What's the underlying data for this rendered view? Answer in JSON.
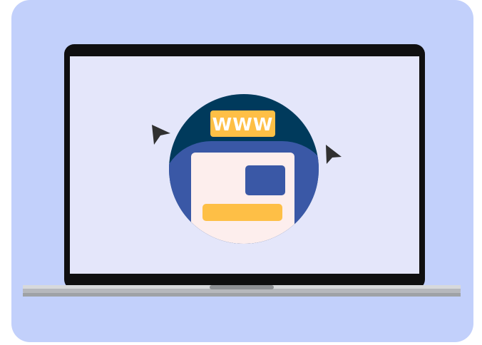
{
  "illustration": {
    "badge_text": "WWW",
    "colors": {
      "background": "#c2d0fb",
      "bezel": "#0f0f10",
      "screen": "#e4e6fa",
      "base_top": "#d7d9dc",
      "base_bottom": "#9fa2a6",
      "circle_dark": "#003a5c",
      "circle_blue": "#3a58a6",
      "page": "#fdeeed",
      "badge": "#febf46",
      "badge_text": "#ffffff",
      "image_block": "#3a58a6",
      "text_bar": "#febf46",
      "cursor": "#303030"
    },
    "icons": [
      "laptop-icon",
      "website-globe-icon",
      "cursor-arrow-icon",
      "cursor-arrow-icon"
    ]
  }
}
